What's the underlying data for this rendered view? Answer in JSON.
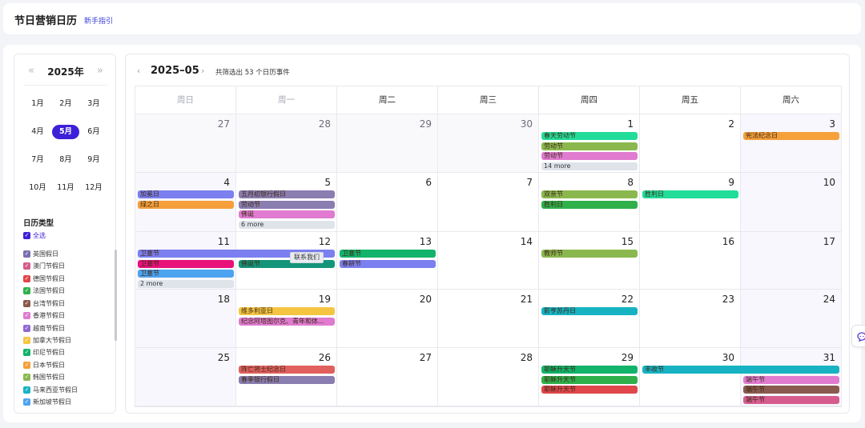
{
  "header": {
    "title": "节日营销日历",
    "guide_link": "新手指引"
  },
  "year_nav": {
    "year": "2025年",
    "prev": "«",
    "next": "»"
  },
  "months": [
    "1月",
    "2月",
    "3月",
    "4月",
    "5月",
    "6月",
    "7月",
    "8月",
    "9月",
    "10月",
    "11月",
    "12月"
  ],
  "selected_month": "5月",
  "categories": {
    "title": "日历类型",
    "items": [
      {
        "label": "全选",
        "color": "#3d21d8"
      },
      {
        "label": "英国假日",
        "color": "#7a6fb0"
      },
      {
        "label": "澳门节假日",
        "color": "#d65c8e"
      },
      {
        "label": "德国节假日",
        "color": "#e0464a"
      },
      {
        "label": "法国节假日",
        "color": "#2fb04a"
      },
      {
        "label": "台湾节假日",
        "color": "#8a5a4e"
      },
      {
        "label": "香港节假日",
        "color": "#e07bd0"
      },
      {
        "label": "越南节假日",
        "color": "#9169d2"
      },
      {
        "label": "加拿大节假日",
        "color": "#f5c542"
      },
      {
        "label": "印尼节假日",
        "color": "#12b36a"
      },
      {
        "label": "日本节假日",
        "color": "#f5a03a"
      },
      {
        "label": "韩国节假日",
        "color": "#8bb84e"
      },
      {
        "label": "马来西亚节假日",
        "color": "#17b3c2"
      },
      {
        "label": "新加坡节假日",
        "color": "#4ea3f0"
      }
    ]
  },
  "calendar": {
    "prev": "‹",
    "next": "›",
    "year_month": "2025–05",
    "count_text": "共筛选出 53 个日历事件",
    "weekdays": [
      "周日",
      "周一",
      "周二",
      "周三",
      "周四",
      "周五",
      "周六"
    ],
    "weeks": [
      [
        "27",
        "28",
        "29",
        "30",
        "1",
        "2",
        "3"
      ],
      [
        "4",
        "5",
        "6",
        "7",
        "8",
        "9",
        "10"
      ],
      [
        "11",
        "12",
        "13",
        "14",
        "15",
        "16",
        "17"
      ],
      [
        "18",
        "19",
        "20",
        "21",
        "22",
        "23",
        "24"
      ],
      [
        "25",
        "26",
        "27",
        "28",
        "29",
        "30",
        "31"
      ]
    ],
    "events": [
      {
        "label": "春天劳动节",
        "color": "#22dc9a"
      },
      {
        "label": "劳动节",
        "color": "#8bb84e"
      },
      {
        "label": "劳动节",
        "color": "#e07bd0"
      },
      {
        "label": "宪法纪念日",
        "color": "#f5a03a"
      },
      {
        "label": "加冕日",
        "color": "#7b7ff0"
      },
      {
        "label": "绿之日",
        "color": "#f5a03a"
      },
      {
        "label": "五月初银行假日",
        "color": "#8a7db0"
      },
      {
        "label": "劳动节",
        "color": "#8a7db0"
      },
      {
        "label": "佛诞",
        "color": "#e07bd0"
      },
      {
        "label": "双亲节",
        "color": "#8bb84e"
      },
      {
        "label": "胜利日",
        "color": "#2fb04a"
      },
      {
        "label": "胜利日",
        "color": "#22dc9a"
      },
      {
        "label": "卫塞节",
        "color": "#7b7ff0"
      },
      {
        "label": "卫塞节",
        "color": "#e8127a"
      },
      {
        "label": "卫塞节",
        "color": "#4ea3f0"
      },
      {
        "label": "佛诞节",
        "color": "#14957a"
      },
      {
        "label": "卫塞节",
        "color": "#12b36a"
      },
      {
        "label": "春耕节",
        "color": "#7b7ff0"
      },
      {
        "label": "教师节",
        "color": "#8bb84e"
      },
      {
        "label": "维多利亚日",
        "color": "#f5c542"
      },
      {
        "label": "纪念阿塔图尔克、青年和体...",
        "color": "#e07bd0"
      },
      {
        "label": "影亨苏丹日",
        "color": "#17b3c2"
      },
      {
        "label": "阵亡将士纪念日",
        "color": "#e0605e"
      },
      {
        "label": "春季银行假日",
        "color": "#8a7db0"
      },
      {
        "label": "耶稣升天节",
        "color": "#12b36a"
      },
      {
        "label": "耶稣升天节",
        "color": "#2fb04a"
      },
      {
        "label": "耶稣升天节",
        "color": "#e0464a"
      },
      {
        "label": "丰收节",
        "color": "#17b3c2"
      },
      {
        "label": "端午节",
        "color": "#e07bd0"
      },
      {
        "label": "端午节",
        "color": "#8a5a4e"
      },
      {
        "label": "端午节",
        "color": "#d65c8e"
      }
    ],
    "more": [
      "14 more",
      "6 more",
      "2 more"
    ],
    "tooltip": "联系我们"
  }
}
